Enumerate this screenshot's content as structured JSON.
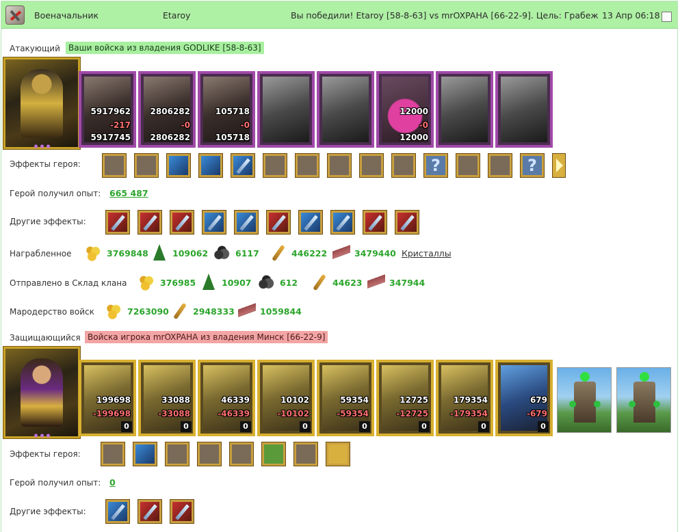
{
  "header": {
    "role": "Военачальник",
    "player": "Etaroy",
    "result": "Вы победили! Etaroy [58-8-63] vs mrOXPAHA [66-22-9]. Цель: Грабеж",
    "date": "13 Апр 06:18"
  },
  "attacker": {
    "label": "Атакующий",
    "banner": "Ваши войска из владения GODLIKE [58-8-63]",
    "units": [
      {
        "c1": "5917962",
        "c2": "-217",
        "c3": "5917745",
        "style": "normal"
      },
      {
        "c1": "2806282",
        "c2": "-0",
        "c3": "2806282",
        "style": "normal"
      },
      {
        "c1": "105718",
        "c2": "-0",
        "c3": "105718",
        "style": "normal"
      },
      {
        "c1": "",
        "c2": "",
        "c3": "",
        "style": "gray"
      },
      {
        "c1": "",
        "c2": "",
        "c3": "",
        "style": "gray"
      },
      {
        "c1": "12000",
        "c2": "-0",
        "c3": "12000",
        "style": "pink"
      },
      {
        "c1": "",
        "c2": "",
        "c3": "",
        "style": "gray"
      },
      {
        "c1": "",
        "c2": "",
        "c3": "",
        "style": "gray"
      }
    ],
    "hero_effects_label": "Эффекты героя:",
    "hero_effects": [
      "fortress-icon",
      "dice-icon",
      "shield-icon",
      "handshake-shield-icon",
      "sword-icon",
      "handshake-sword-icon",
      "hand-icon",
      "treasure-icon",
      "fire-gold-icon",
      "skull-gold-icon",
      "question-icon",
      "battle-icon",
      "totem-icon",
      "question-icon"
    ],
    "exp_label": "Герой получил опыт:",
    "exp_value": "665 487",
    "other_effects_label": "Другие эффекты:",
    "other_effects": [
      "fist-sword-icon",
      "fist-sword-icon",
      "heart-sword-icon",
      "sword-icon",
      "sword-icon",
      "heart-sword-icon",
      "sword-icon",
      "sword-icon",
      "fist-sword-icon",
      "fist-sword-icon"
    ]
  },
  "loot": {
    "label": "Награбленное",
    "items": [
      {
        "icon": "gold-icon",
        "value": "3769848"
      },
      {
        "icon": "wood-icon",
        "value": "109062"
      },
      {
        "icon": "ore-icon",
        "value": "6117"
      },
      {
        "icon": "wheat-icon",
        "value": "446222"
      },
      {
        "icon": "crystal-icon",
        "value": "3479440"
      }
    ],
    "crystals_link": "Кристаллы"
  },
  "clan_storage": {
    "label": "Отправлено в Склад клана",
    "items": [
      {
        "icon": "gold-icon",
        "value": "376985"
      },
      {
        "icon": "wood-icon",
        "value": "10907"
      },
      {
        "icon": "ore-icon",
        "value": "612"
      },
      {
        "icon": "wheat-icon",
        "value": "44623"
      },
      {
        "icon": "crystal-icon",
        "value": "347944"
      }
    ]
  },
  "marauding": {
    "label": "Мародерство войск",
    "items": [
      {
        "icon": "gold-icon",
        "value": "7263090"
      },
      {
        "icon": "wheat-icon",
        "value": "2948333"
      },
      {
        "icon": "crystal-icon",
        "value": "1059844"
      }
    ]
  },
  "defender": {
    "label": "Защищающийся",
    "banner": "Войска игрока mrOXPAHA из владения Минск [66-22-9]",
    "units": [
      {
        "c1": "199698",
        "c2": "-199698",
        "c3": "0",
        "style": "normal"
      },
      {
        "c1": "33088",
        "c2": "-33088",
        "c3": "0",
        "style": "normal"
      },
      {
        "c1": "46339",
        "c2": "-46339",
        "c3": "0",
        "style": "normal"
      },
      {
        "c1": "10102",
        "c2": "-10102",
        "c3": "0",
        "style": "normal"
      },
      {
        "c1": "59354",
        "c2": "-59354",
        "c3": "0",
        "style": "normal"
      },
      {
        "c1": "12725",
        "c2": "-12725",
        "c3": "0",
        "style": "normal"
      },
      {
        "c1": "179354",
        "c2": "-179354",
        "c3": "0",
        "style": "normal"
      },
      {
        "c1": "679",
        "c2": "-679",
        "c3": "0",
        "style": "blue"
      }
    ],
    "hero_effects_label": "Эффекты героя:",
    "hero_effects": [
      "fortress-icon",
      "shield-icon",
      "ring-icon",
      "armor-icon",
      "amulet-icon",
      "clover-icon",
      "bow-icon",
      "clover-icon"
    ],
    "exp_label": "Герой получил опыт:",
    "exp_value": "0",
    "other_effects_label": "Другие эффекты:",
    "other_effects": [
      "sword-icon",
      "fist-sword-icon",
      "fist-sword-icon"
    ]
  }
}
